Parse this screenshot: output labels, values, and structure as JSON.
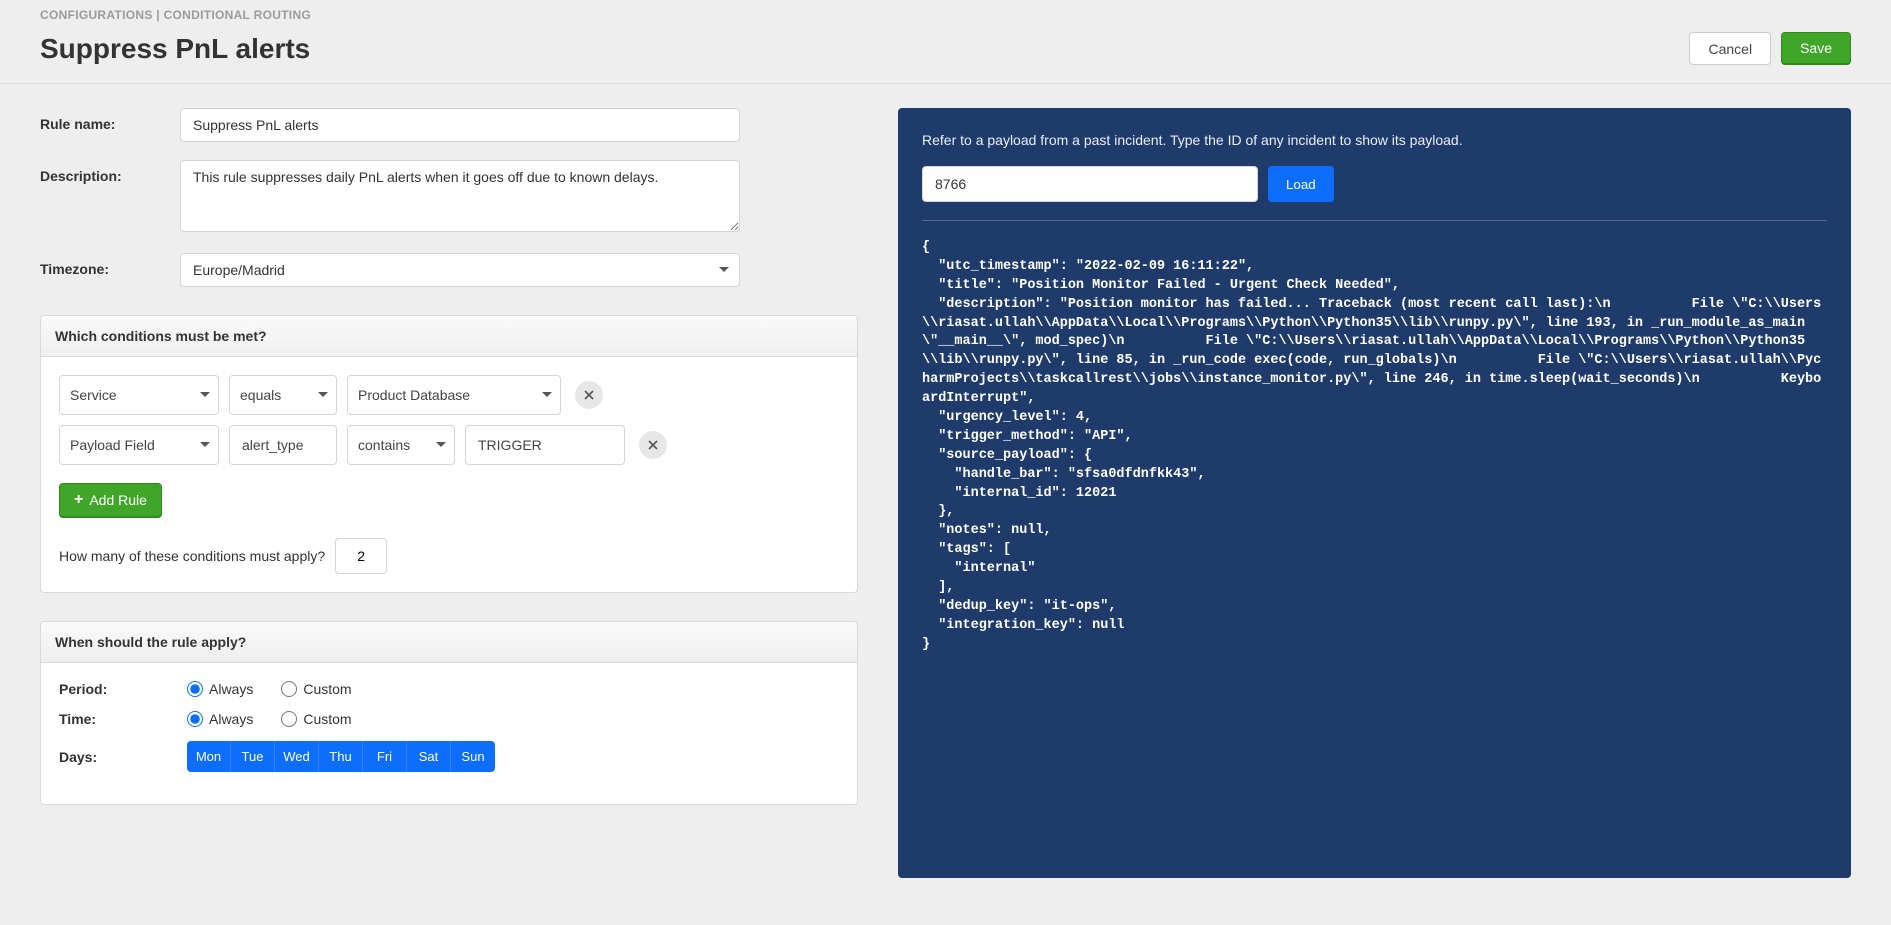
{
  "breadcrumb": "CONFIGURATIONS | CONDITIONAL ROUTING",
  "page_title": "Suppress PnL alerts",
  "actions": {
    "cancel": "Cancel",
    "save": "Save"
  },
  "fields": {
    "rule_name_label": "Rule name:",
    "rule_name_value": "Suppress PnL alerts",
    "description_label": "Description:",
    "description_value": "This rule suppresses daily PnL alerts when it goes off due to known delays.",
    "timezone_label": "Timezone:",
    "timezone_value": "Europe/Madrid"
  },
  "conditions_panel": {
    "title": "Which conditions must be met?",
    "rows": [
      {
        "field": "Service",
        "field_custom": "",
        "operator": "equals",
        "value_select": "Product Database",
        "value_text": ""
      },
      {
        "field": "Payload Field",
        "field_custom": "alert_type",
        "operator": "contains",
        "value_select": "",
        "value_text": "TRIGGER"
      }
    ],
    "add_rule_label": "Add Rule",
    "howmany_label": "How many of these conditions must apply?",
    "howmany_value": "2"
  },
  "when_panel": {
    "title": "When should the rule apply?",
    "period_label": "Period:",
    "time_label": "Time:",
    "days_label": "Days:",
    "always_label": "Always",
    "custom_label": "Custom",
    "days": [
      "Mon",
      "Tue",
      "Wed",
      "Thu",
      "Fri",
      "Sat",
      "Sun"
    ]
  },
  "payload_panel": {
    "intro": "Refer to a payload from a past incident. Type the ID of any incident to show its payload.",
    "search_value": "8766",
    "load_label": "Load",
    "payload_text": "{\n  \"utc_timestamp\": \"2022-02-09 16:11:22\",\n  \"title\": \"Position Monitor Failed - Urgent Check Needed\",\n  \"description\": \"Position monitor has failed... Traceback (most recent call last):\\n          File \\\"C:\\\\Users\\\\riasat.ullah\\\\AppData\\\\Local\\\\Programs\\\\Python\\\\Python35\\\\lib\\\\runpy.py\\\", line 193, in _run_module_as_main \\\"__main__\\\", mod_spec)\\n          File \\\"C:\\\\Users\\\\riasat.ullah\\\\AppData\\\\Local\\\\Programs\\\\Python\\\\Python35\\\\lib\\\\runpy.py\\\", line 85, in _run_code exec(code, run_globals)\\n          File \\\"C:\\\\Users\\\\riasat.ullah\\\\PycharmProjects\\\\taskcallrest\\\\jobs\\\\instance_monitor.py\\\", line 246, in time.sleep(wait_seconds)\\n          KeyboardInterrupt\",\n  \"urgency_level\": 4,\n  \"trigger_method\": \"API\",\n  \"source_payload\": {\n    \"handle_bar\": \"sfsa0dfdnfkk43\",\n    \"internal_id\": 12021\n  },\n  \"notes\": null,\n  \"tags\": [\n    \"internal\"\n  ],\n  \"dedup_key\": \"it-ops\",\n  \"integration_key\": null\n}"
  }
}
